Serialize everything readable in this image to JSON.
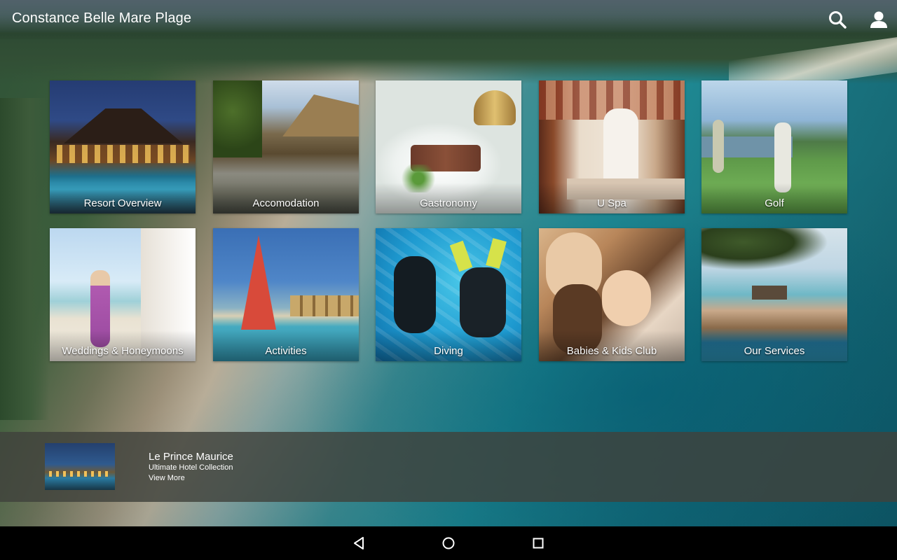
{
  "app": {
    "title": "Constance Belle Mare Plage",
    "icons": {
      "search": "search-icon",
      "account": "person-icon"
    }
  },
  "tiles": [
    {
      "label": "Resort Overview"
    },
    {
      "label": "Accomodation"
    },
    {
      "label": "Gastronomy"
    },
    {
      "label": "U Spa"
    },
    {
      "label": "Golf"
    },
    {
      "label": "Weddings & Honeymoons"
    },
    {
      "label": "Activities"
    },
    {
      "label": "Diving"
    },
    {
      "label": "Babies & Kids Club"
    },
    {
      "label": "Our Services"
    }
  ],
  "promo": {
    "title": "Le Prince Maurice",
    "subtitle": "Ultimate Hotel Collection",
    "link": "View More"
  },
  "navbar": {
    "icons": [
      "back-icon",
      "home-icon",
      "recents-icon"
    ]
  },
  "colors": {
    "text": "#ffffff",
    "promo_bar": "#40423c",
    "navbar": "#000000"
  }
}
